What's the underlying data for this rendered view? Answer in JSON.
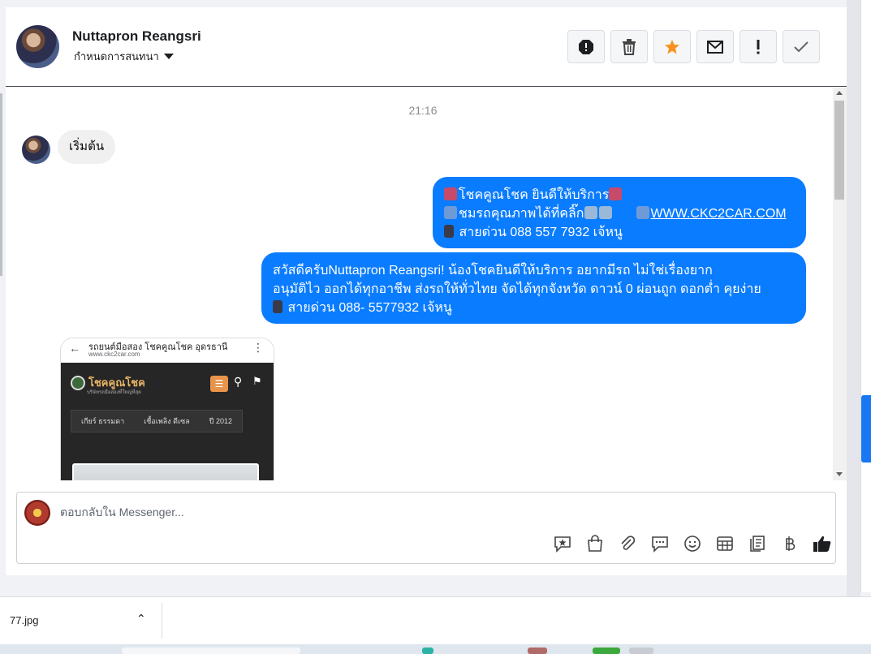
{
  "header": {
    "name": "Nuttapron Reangsri",
    "subtitle": "กำหนดการสนทนา",
    "actions": [
      {
        "name": "spam-icon"
      },
      {
        "name": "trash-icon"
      },
      {
        "name": "star-icon",
        "color": "#f7931e"
      },
      {
        "name": "envelope-icon"
      },
      {
        "name": "exclamation-icon"
      },
      {
        "name": "check-icon"
      }
    ]
  },
  "conversation": {
    "time": "21:16",
    "incoming": "เริ่มต้น",
    "outgoing1": {
      "line1": "โชคคูณโชค ยินดีให้บริการ",
      "line2": "ชมรถคุณภาพได้ที่คลิ๊ก",
      "link": "WWW.CKC2CAR.COM",
      "line3": "สายด่วน 088 557 7932 เจ้หนู"
    },
    "outgoing2": {
      "line1": "สวัสดีครับNuttapron Reangsri! น้องโชคยินดีให้บริการ อยากมีรถ ไม่ใช่เรื่องยาก",
      "line2": "อนุมัติไว ออกได้ทุกอาชีพ ส่งรถให้ทั่วไทย จัดได้ทุกจังหวัด ดาวน์ 0  ผ่อนถูก ดอกต่ำ คุยง่าย",
      "line3": "สายด่วน 088- 5577932 เจ้หนู"
    },
    "image": {
      "title": "รถยนต์มือสอง โชคคูณโชค อุดรธานี",
      "url": "www.ckc2car.com",
      "logo": "โชคคูณโชค",
      "logo_sub": "บริษัทรถมือสองที่ใหญ่ที่สุด",
      "specs": [
        "เกียร์ ธรรมดา",
        "เชื้อเพลิง ดีเซล",
        "ปี 2012"
      ]
    }
  },
  "reply": {
    "placeholder": "ตอบกลับใน Messenger...",
    "tools": [
      "saved-reply-icon",
      "shop-bag-icon",
      "attachment-icon",
      "comment-icon",
      "emoji-icon",
      "table-icon",
      "notes-icon",
      "baht-icon",
      "thumbs-up-icon"
    ]
  },
  "downloads": {
    "file": "77.jpg"
  },
  "colors": {
    "bubble_blue": "#0a7cff",
    "star_orange": "#f7931e",
    "thumb_dark": "#1c1e21"
  }
}
